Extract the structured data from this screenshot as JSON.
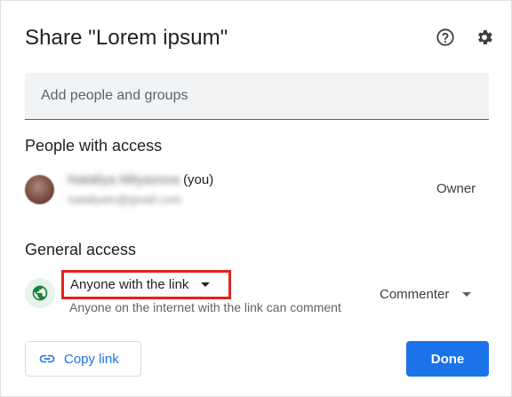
{
  "dialog": {
    "title": "Share \"Lorem ipsum\"",
    "help_icon": "help-circle-icon",
    "settings_icon": "gear-icon"
  },
  "add_people": {
    "placeholder": "Add people and groups"
  },
  "people_section": {
    "title": "People with access",
    "person": {
      "name": "Nataliya Mityazova",
      "you_suffix": "(you)",
      "email": "nataliyam@gmail.com",
      "role": "Owner"
    }
  },
  "general_access": {
    "title": "General access",
    "icon": "globe-icon",
    "access_level": "Anyone with the link",
    "description": "Anyone on the internet with the link can comment",
    "role": "Commenter"
  },
  "footer": {
    "copy_link_label": "Copy link",
    "copy_link_icon": "link-icon",
    "done_label": "Done"
  },
  "colors": {
    "accent": "#1a73e8",
    "highlight_border": "#e2231a",
    "globe_bg": "#e6f4ea",
    "globe_fg": "#188038"
  }
}
